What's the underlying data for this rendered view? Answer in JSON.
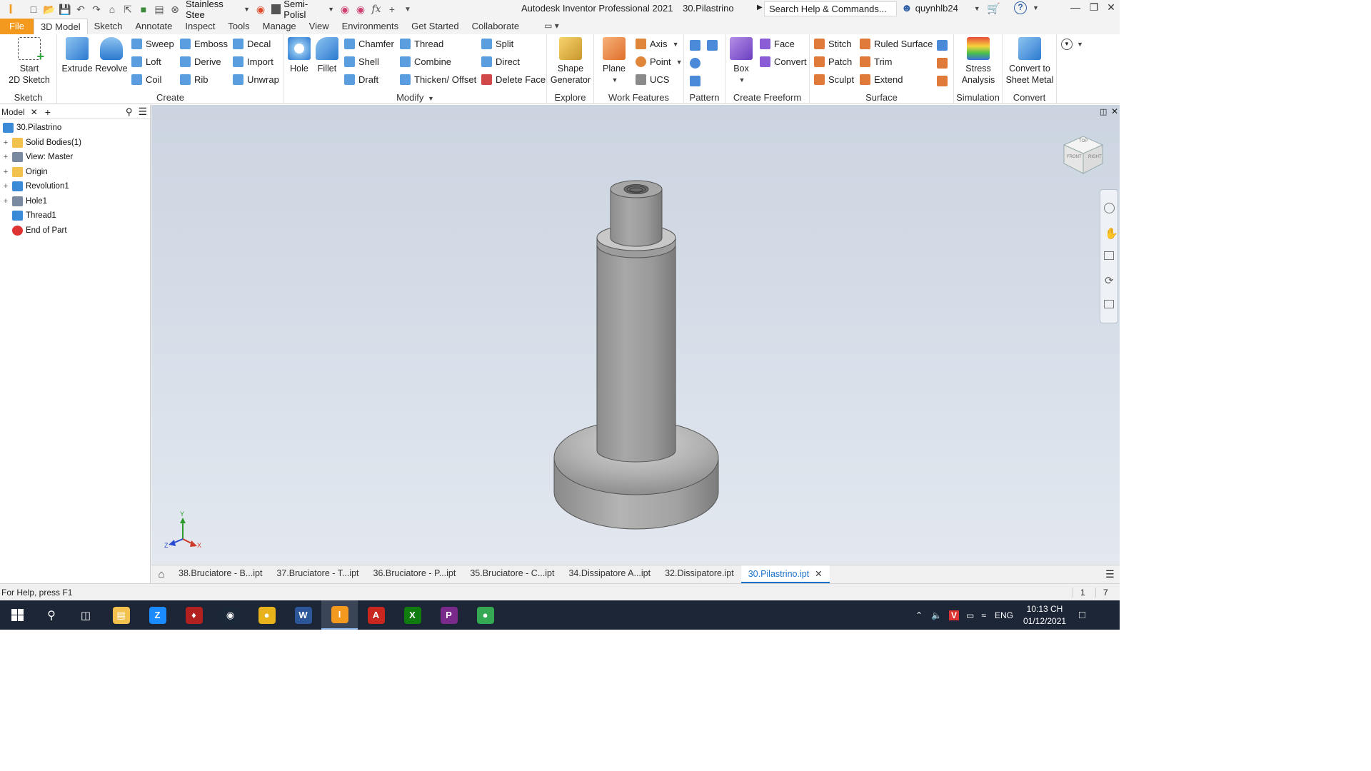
{
  "titlebar": {
    "material": "Stainless Stee",
    "appearance": "Semi-Polisl",
    "app_title": "Autodesk Inventor Professional 2021",
    "document_title": "30.Pilastrino",
    "search_placeholder": "Search Help & Commands...",
    "user": "quynhlb24"
  },
  "tabs": [
    "File",
    "3D Model",
    "Sketch",
    "Annotate",
    "Inspect",
    "Tools",
    "Manage",
    "View",
    "Environments",
    "Get Started",
    "Collaborate"
  ],
  "active_tab": "3D Model",
  "ribbon": {
    "sketch": {
      "title": "Sketch",
      "start_sketch": "Start",
      "start_sketch_2": "2D Sketch"
    },
    "create": {
      "title": "Create",
      "extrude": "Extrude",
      "revolve": "Revolve",
      "sweep": "Sweep",
      "emboss": "Emboss",
      "decal": "Decal",
      "loft": "Loft",
      "derive": "Derive",
      "import": "Import",
      "coil": "Coil",
      "rib": "Rib",
      "unwrap": "Unwrap"
    },
    "modify": {
      "title": "Modify",
      "hole": "Hole",
      "fillet": "Fillet",
      "chamfer": "Chamfer",
      "thread": "Thread",
      "split": "Split",
      "shell": "Shell",
      "combine": "Combine",
      "direct": "Direct",
      "draft": "Draft",
      "thicken": "Thicken/ Offset",
      "delete_face": "Delete Face"
    },
    "explore": {
      "title": "Explore",
      "shape_generator": "Shape",
      "shape_generator_2": "Generator"
    },
    "work_features": {
      "title": "Work Features",
      "plane": "Plane",
      "axis": "Axis",
      "point": "Point",
      "ucs": "UCS"
    },
    "pattern": {
      "title": "Pattern"
    },
    "freeform": {
      "title": "Create Freeform",
      "box": "Box",
      "face": "Face",
      "convert": "Convert"
    },
    "surface": {
      "title": "Surface",
      "stitch": "Stitch",
      "ruled_surface": "Ruled Surface",
      "patch": "Patch",
      "trim": "Trim",
      "sculpt": "Sculpt",
      "extend": "Extend"
    },
    "simulation": {
      "title": "Simulation",
      "stress": "Stress",
      "stress_2": "Analysis"
    },
    "convert": {
      "title": "Convert",
      "sheet_metal": "Convert to",
      "sheet_metal_2": "Sheet Metal"
    }
  },
  "browser": {
    "tab": "Model",
    "root": "30.Pilastrino",
    "items": [
      {
        "label": "Solid Bodies(1)",
        "icon": "folder-icon"
      },
      {
        "label": "View: Master",
        "icon": "view-icon"
      },
      {
        "label": "Origin",
        "icon": "folder-icon"
      },
      {
        "label": "Revolution1",
        "icon": "revolve-icon"
      },
      {
        "label": "Hole1",
        "icon": "hole-icon"
      },
      {
        "label": "Thread1",
        "icon": "thread-icon"
      },
      {
        "label": "End of Part",
        "icon": "end-of-part-icon"
      }
    ]
  },
  "viewcube": {
    "top": "TOP",
    "front": "FRONT",
    "right": "RIGHT"
  },
  "axes": {
    "x": "X",
    "y": "Y",
    "z": "Z"
  },
  "doc_tabs": [
    "38.Bruciatore - B...ipt",
    "37.Bruciatore - T...ipt",
    "36.Bruciatore - P...ipt",
    "35.Bruciatore - C...ipt",
    "34.Dissipatore A...ipt",
    "32.Dissipatore.ipt",
    "30.Pilastrino.ipt"
  ],
  "active_doc_tab": "30.Pilastrino.ipt",
  "status": {
    "help": "For Help, press F1",
    "count1": "1",
    "count2": "7"
  },
  "taskbar": {
    "apps": [
      "File Explorer",
      "Zalo",
      "Game",
      "Steam",
      "Chrome",
      "Word",
      "Inventor",
      "Acrobat",
      "Xbox",
      "PDF",
      "Chrome Beta"
    ],
    "language": "ENG",
    "time": "10:13 CH",
    "date": "01/12/2021"
  },
  "colors": {
    "file_tab": "#f39a1e",
    "accent": "#1a73c9",
    "taskbar": "#1c2636"
  }
}
